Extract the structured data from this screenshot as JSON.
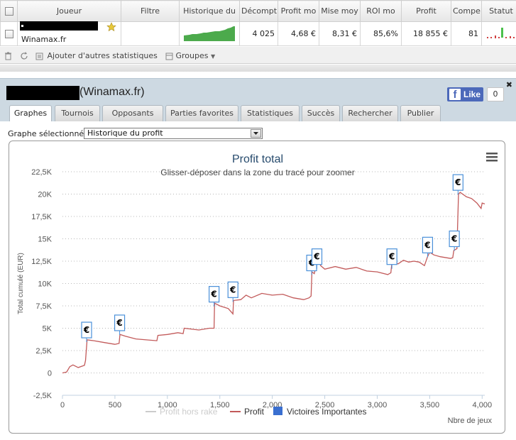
{
  "table": {
    "headers": [
      "Joueur",
      "Filtre",
      "Historique du",
      "Décompt",
      "Profit mo",
      "Mise moy",
      "ROI mo",
      "Profit",
      "Compe",
      "Statut"
    ],
    "row": {
      "site": "Winamax.fr",
      "decompte": "4 025",
      "profit_moy": "4,68 €",
      "mise_moy": "8,31 €",
      "roi_moy": "85,6%",
      "profit": "18 855 €",
      "compe": "81",
      "close": "x"
    }
  },
  "toolbar": {
    "add_stats": "Ajouter d'autres statistiques",
    "groups": "Groupes"
  },
  "panel": {
    "title": "(Winamax.fr)",
    "fb_like": "Like",
    "fb_count": "0",
    "tabs": [
      "Graphes",
      "Tournois",
      "Opposants",
      "Parties favorites",
      "Statistiques",
      "Succès",
      "Rechercher",
      "Publier"
    ],
    "active_tab": "Graphes",
    "graph_label": "Graphe sélectionné :",
    "graph_selected": "Historique du profit"
  },
  "colors": {
    "profit_line": "#c25a5a",
    "profit_hors_rake": "#cccccc",
    "victoires": "#3a6fd0",
    "marker_border": "#4a90d9"
  },
  "chart_data": {
    "type": "line",
    "title": "Profit total",
    "subtitle": "Glisser-déposer dans la zone du tracé pour zoomer",
    "xlabel": "Nbre de jeux",
    "ylabel": "Total cumulé (EUR)",
    "xlim": [
      0,
      4025
    ],
    "ylim": [
      -2500,
      22500
    ],
    "xticks": [
      0,
      500,
      1000,
      1500,
      2000,
      2500,
      3000,
      3500,
      4000
    ],
    "xtick_labels": [
      "0",
      "500",
      "1,000",
      "1,500",
      "2,000",
      "2,500",
      "3,000",
      "3,500",
      "4,000"
    ],
    "yticks": [
      -2500,
      0,
      2500,
      5000,
      7500,
      10000,
      12500,
      15000,
      17500,
      20000,
      22500
    ],
    "ytick_labels": [
      "-2,5K",
      "0",
      "2,5K",
      "5K",
      "7,5K",
      "10K",
      "12,5K",
      "15K",
      "17,5K",
      "20K",
      "22,5K"
    ],
    "grid": true,
    "legend_position": "bottom",
    "legend": [
      "Profit hors rake",
      "Profit",
      "Victoires Importantes"
    ],
    "series": [
      {
        "name": "Profit",
        "points": [
          [
            0,
            0
          ],
          [
            40,
            100
          ],
          [
            70,
            700
          ],
          [
            100,
            900
          ],
          [
            150,
            600
          ],
          [
            210,
            850
          ],
          [
            220,
            1400
          ],
          [
            235,
            3700
          ],
          [
            300,
            3600
          ],
          [
            400,
            3400
          ],
          [
            500,
            3200
          ],
          [
            540,
            3300
          ],
          [
            548,
            4300
          ],
          [
            600,
            4100
          ],
          [
            700,
            3800
          ],
          [
            800,
            3700
          ],
          [
            900,
            3600
          ],
          [
            910,
            4200
          ],
          [
            1000,
            4300
          ],
          [
            1100,
            4500
          ],
          [
            1150,
            4400
          ],
          [
            1160,
            5000
          ],
          [
            1300,
            4800
          ],
          [
            1400,
            5000
          ],
          [
            1445,
            5000
          ],
          [
            1450,
            7800
          ],
          [
            1500,
            7500
          ],
          [
            1580,
            7200
          ],
          [
            1625,
            6600
          ],
          [
            1630,
            8100
          ],
          [
            1700,
            8200
          ],
          [
            1750,
            8700
          ],
          [
            1800,
            8400
          ],
          [
            1900,
            8900
          ],
          [
            2000,
            8700
          ],
          [
            2100,
            8800
          ],
          [
            2200,
            8400
          ],
          [
            2300,
            8200
          ],
          [
            2350,
            8400
          ],
          [
            2370,
            8600
          ],
          [
            2378,
            11300
          ],
          [
            2400,
            11100
          ],
          [
            2420,
            12100
          ],
          [
            2440,
            12800
          ],
          [
            2460,
            12000
          ],
          [
            2500,
            11600
          ],
          [
            2600,
            11900
          ],
          [
            2700,
            11600
          ],
          [
            2800,
            11800
          ],
          [
            2900,
            11400
          ],
          [
            3000,
            11300
          ],
          [
            3100,
            11000
          ],
          [
            3130,
            11200
          ],
          [
            3140,
            12400
          ],
          [
            3200,
            12200
          ],
          [
            3250,
            12600
          ],
          [
            3300,
            12400
          ],
          [
            3350,
            12500
          ],
          [
            3400,
            12400
          ],
          [
            3450,
            12000
          ],
          [
            3480,
            13000
          ],
          [
            3500,
            13500
          ],
          [
            3540,
            13200
          ],
          [
            3600,
            13000
          ],
          [
            3700,
            12800
          ],
          [
            3720,
            12900
          ],
          [
            3730,
            13700
          ],
          [
            3760,
            13900
          ],
          [
            3775,
            20000
          ],
          [
            3790,
            20200
          ],
          [
            3850,
            19700
          ],
          [
            3900,
            19500
          ],
          [
            3950,
            19000
          ],
          [
            3990,
            18400
          ],
          [
            4000,
            19000
          ],
          [
            4025,
            18900
          ]
        ]
      }
    ],
    "markers": [
      {
        "x": 230,
        "y": 4800
      },
      {
        "x": 545,
        "y": 5600
      },
      {
        "x": 1445,
        "y": 8800
      },
      {
        "x": 1625,
        "y": 9300
      },
      {
        "x": 2375,
        "y": 12300
      },
      {
        "x": 2425,
        "y": 13000
      },
      {
        "x": 3140,
        "y": 13000
      },
      {
        "x": 3480,
        "y": 14300
      },
      {
        "x": 3735,
        "y": 15000
      },
      {
        "x": 3770,
        "y": 21300
      }
    ]
  }
}
